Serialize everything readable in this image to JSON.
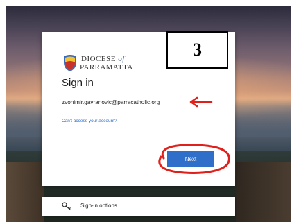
{
  "brand": {
    "line1": "DIOCESE",
    "of": "of",
    "line2": "PARRAMATTA"
  },
  "signin": {
    "title": "Sign in",
    "email_value": "zvonimir.gavranovic@parracatholic.org",
    "cant_access_link": "Can't access your account?",
    "next_label": "Next"
  },
  "options": {
    "label": "Sign-in options"
  },
  "annotation": {
    "step_number": "3",
    "color": "#e0201a"
  },
  "icons": {
    "logo": "diocese-shield-icon",
    "options": "key-icon"
  }
}
